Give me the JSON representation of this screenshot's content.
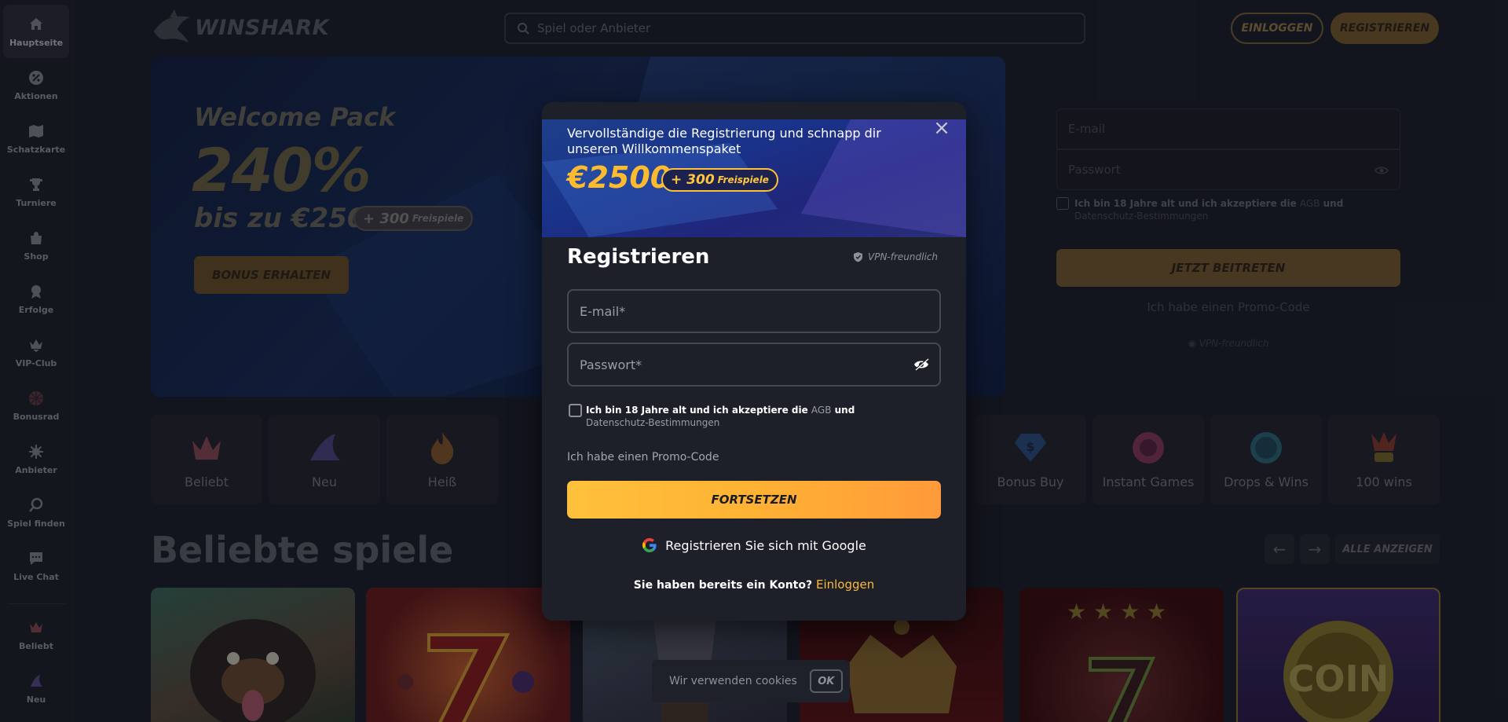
{
  "brand": {
    "name": "WINSHARK"
  },
  "header": {
    "search_placeholder": "Spiel oder Anbieter",
    "login_label": "EINLOGGEN",
    "register_label": "REGISTRIEREN"
  },
  "sidebar": {
    "items": [
      {
        "label": "Hauptseite",
        "icon": "home-icon"
      },
      {
        "label": "Aktionen",
        "icon": "percent-icon"
      },
      {
        "label": "Schatzkarte",
        "icon": "map-icon"
      },
      {
        "label": "Turniere",
        "icon": "trophy-icon"
      },
      {
        "label": "Shop",
        "icon": "shop-bag-icon"
      },
      {
        "label": "Erfolge",
        "icon": "achievement-icon"
      },
      {
        "label": "VIP-Club",
        "icon": "vip-icon"
      },
      {
        "label": "Bonusrad",
        "icon": "wheel-icon"
      },
      {
        "label": "Anbieter",
        "icon": "provider-icon"
      },
      {
        "label": "Spiel finden",
        "icon": "search-icon"
      },
      {
        "label": "Live Chat",
        "icon": "chat-icon"
      },
      {
        "label": "Beliebt",
        "icon": "crown-icon"
      },
      {
        "label": "Neu",
        "icon": "shark-fin-icon"
      }
    ]
  },
  "banner": {
    "title": "Welcome Pack",
    "percent": "240%",
    "upto": "bis zu €2500",
    "spins_amount": "+ 300",
    "spins_label": "Freispiele",
    "cta": "BONUS ERHALTEN"
  },
  "right_panel": {
    "email_placeholder": "E-mail",
    "password_placeholder": "Passwort",
    "check_text_a": "Ich bin 18 Jahre alt und ich akzeptiere die",
    "agb": "AGB",
    "und": "und",
    "privacy": "Datenschutz-Bestimmungen",
    "join_label": "JETZT BEITRETEN",
    "promo_label": "Ich habe einen Promo-Code",
    "vpn_label": "VPN-freundlich"
  },
  "categories": [
    {
      "label": "Beliebt",
      "icon": "crown-icon"
    },
    {
      "label": "Neu",
      "icon": "shark-fin-icon"
    },
    {
      "label": "Heiß",
      "icon": "flame-icon"
    },
    {
      "label": "Bonus Buy",
      "icon": "diamond-dollar-icon"
    },
    {
      "label": "Instant Games",
      "icon": "instant-games-icon"
    },
    {
      "label": "Drops & Wins",
      "icon": "drops-wins-icon"
    },
    {
      "label": "100 wins",
      "icon": "jester-100-icon"
    }
  ],
  "popular": {
    "title": "Beliebte spiele",
    "prev_icon": "←",
    "next_icon": "→",
    "show_all": "ALLE ANZEIGEN"
  },
  "cookie": {
    "text": "Wir verwenden cookies",
    "ok": "OK"
  },
  "modal": {
    "header_text": "Vervollständige die Registrierung und schnapp dir unseren Willkommenspaket",
    "amount": "€2500",
    "spins_amount": "+ 300",
    "spins_label": "Freispiele",
    "close_icon": "×",
    "title": "Registrieren",
    "vpn_label": "VPN-freundlich",
    "email_placeholder": "E-mail*",
    "password_placeholder": "Passwort*",
    "check_text_a": "Ich bin 18 Jahre alt und ich akzeptiere die",
    "agb": "AGB",
    "und": "und",
    "privacy": "Datenschutz-Bestimmungen",
    "promo_label": "Ich habe einen Promo-Code",
    "submit_label": "FORTSETZEN",
    "google_label": "Registrieren Sie sich mit Google",
    "existing_text": "Sie haben bereits ein Konto?",
    "login_link": "Einloggen"
  },
  "colors": {
    "accent_gold": "#ffbb2e",
    "accent_orange": "#ff9a3a",
    "bg": "#1b1e28",
    "panel": "#1d2029"
  }
}
